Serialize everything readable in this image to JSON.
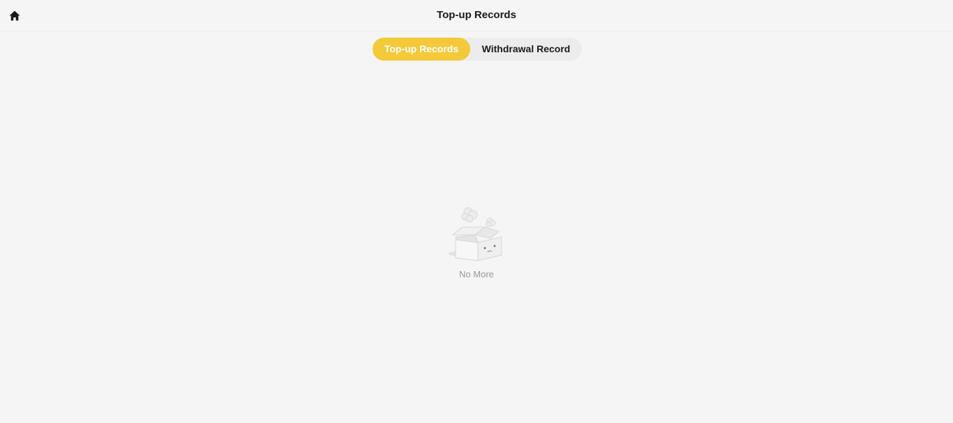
{
  "header": {
    "title": "Top-up Records",
    "home_icon": "home-icon"
  },
  "tabs": [
    {
      "label": "Top-up Records",
      "active": true
    },
    {
      "label": "Withdrawal Record",
      "active": false
    }
  ],
  "empty_state": {
    "illustration": "empty-box-icon",
    "text": "No More"
  },
  "colors": {
    "accent": "#f4c93a",
    "background": "#f5f5f5",
    "muted_text": "#999999"
  }
}
